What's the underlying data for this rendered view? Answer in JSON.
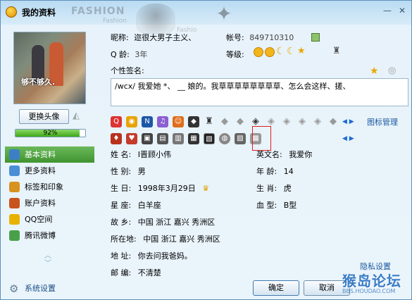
{
  "window": {
    "title": "我的资料",
    "brand": "FASHION",
    "brand_sub": "Fashion",
    "brand_sub2": "Fashio",
    "minimize": "—",
    "close": "✕"
  },
  "sidebar": {
    "avatar_caption": "够不够久.",
    "change_avatar": "更换头像",
    "progress_text": "92%",
    "progress_value": 0.92,
    "items": [
      {
        "label": "基本资料",
        "icon": "profile-card-icon",
        "color": "#3d7fc4",
        "active": true
      },
      {
        "label": "更多资料",
        "icon": "more-info-icon",
        "color": "#4a8fd6",
        "active": false
      },
      {
        "label": "标签和印象",
        "icon": "tag-icon",
        "color": "#d8921f",
        "active": false
      },
      {
        "label": "账户资料",
        "icon": "account-icon",
        "color": "#c8531e",
        "active": false
      },
      {
        "label": "QQ空间",
        "icon": "qzone-star-icon",
        "color": "#e8b200",
        "active": false
      },
      {
        "label": "腾讯微博",
        "icon": "weibo-icon",
        "color": "#4aa04a",
        "active": false
      }
    ],
    "system_settings": "系统设置"
  },
  "profile": {
    "nickname_label": "昵称:",
    "nickname_value": "迩很大男子主义、",
    "account_label": "帐号:",
    "account_value": "849710310",
    "q_age_label": "Q 龄:",
    "q_age_value": "3年",
    "level_label": "等级:",
    "signature_label": "个性签名:",
    "signature_text": "/wcx/           我爱她  *、                    __  娘的。我草草草草草草草草、怎么会这样、搓、",
    "icon_manage": "图标管理"
  },
  "details": {
    "name_label": "姓    名:",
    "name_value": "I晋顾小伟",
    "english_name_label": "英文名:",
    "english_name_value": "我爱你",
    "gender_label": "性    别:",
    "gender_value": "男",
    "age_label": "年    龄:",
    "age_value": "14",
    "birthday_label": "生    日:",
    "birthday_value": "1998年3月29日",
    "zodiac_label": "生    肖:",
    "zodiac_value": "虎",
    "constellation_label": "星    座:",
    "constellation_value": "白羊座",
    "blood_label": "血    型:",
    "blood_value": "B型",
    "hometown_label": "故    乡:",
    "hometown_value": "中国  浙江  嘉兴  秀洲区",
    "location_label": "所在地:",
    "location_value": "中国  浙江  嘉兴  秀洲区",
    "address_label": "地    址:",
    "address_value": "你去问我爸妈。",
    "postcode_label": "邮    编:",
    "postcode_value": "不清楚"
  },
  "actions": {
    "privacy": "隐私设置",
    "ok": "确定",
    "cancel": "取消"
  },
  "watermark": {
    "title": "猴岛论坛",
    "url": "BBS.HOUDAO.COM"
  }
}
